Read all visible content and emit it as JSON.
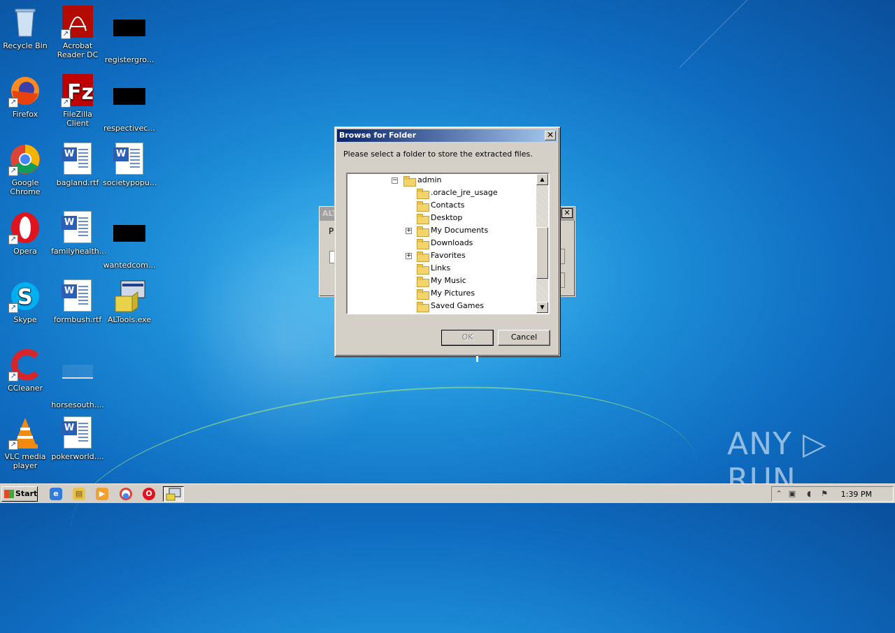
{
  "desktop": {
    "icons": [
      {
        "label": "Recycle Bin",
        "icon": "recycle-bin-icon"
      },
      {
        "label": "Acrobat Reader DC",
        "icon": "acrobat-icon"
      },
      {
        "label": "registergro...",
        "icon": "file-icon"
      },
      {
        "label": "Firefox",
        "icon": "firefox-icon"
      },
      {
        "label": "FileZilla Client",
        "icon": "filezilla-icon"
      },
      {
        "label": "respectivec...",
        "icon": "file-icon"
      },
      {
        "label": "Google Chrome",
        "icon": "chrome-icon"
      },
      {
        "label": "bagland.rtf",
        "icon": "word-doc-icon"
      },
      {
        "label": "societypopu...",
        "icon": "word-doc-icon"
      },
      {
        "label": "Opera",
        "icon": "opera-icon"
      },
      {
        "label": "familyhealth...",
        "icon": "word-doc-icon"
      },
      {
        "label": "wantedcom...",
        "icon": "file-icon"
      },
      {
        "label": "Skype",
        "icon": "skype-icon"
      },
      {
        "label": "formbush.rtf",
        "icon": "word-doc-icon"
      },
      {
        "label": "ALTools.exe",
        "icon": "installer-icon"
      },
      {
        "label": "CCleaner",
        "icon": "ccleaner-icon"
      },
      {
        "label": "horsesouth....",
        "icon": "file-icon"
      },
      {
        "label": "VLC media player",
        "icon": "vlc-icon"
      },
      {
        "label": "pokerworld....",
        "icon": "word-doc-icon"
      }
    ]
  },
  "background_window": {
    "title": "ALT",
    "text": "P"
  },
  "dialog": {
    "title": "Browse for Folder",
    "close_glyph": "✕",
    "message": "Please select a folder to store the extracted files.",
    "tree": [
      {
        "label": "admin",
        "expander": "−"
      },
      {
        "label": ".oracle_jre_usage",
        "expander": ""
      },
      {
        "label": "Contacts",
        "expander": ""
      },
      {
        "label": "Desktop",
        "expander": ""
      },
      {
        "label": "My Documents",
        "expander": "+"
      },
      {
        "label": "Downloads",
        "expander": ""
      },
      {
        "label": "Favorites",
        "expander": "+"
      },
      {
        "label": "Links",
        "expander": ""
      },
      {
        "label": "My Music",
        "expander": ""
      },
      {
        "label": "My Pictures",
        "expander": ""
      },
      {
        "label": "Saved Games",
        "expander": ""
      }
    ],
    "ok_label": "OK",
    "cancel_label": "Cancel"
  },
  "taskbar": {
    "start_label": "Start",
    "quick_launch": [
      "ie-icon",
      "explorer-icon",
      "media-player-icon",
      "chrome-icon",
      "opera-icon"
    ],
    "clock": "1:39 PM"
  },
  "watermark": "ANY ▷ RUN",
  "colors": {
    "title_bar_start": "#0a246a",
    "title_bar_end": "#a6caf0",
    "dialog_face": "#d4d0c8"
  }
}
